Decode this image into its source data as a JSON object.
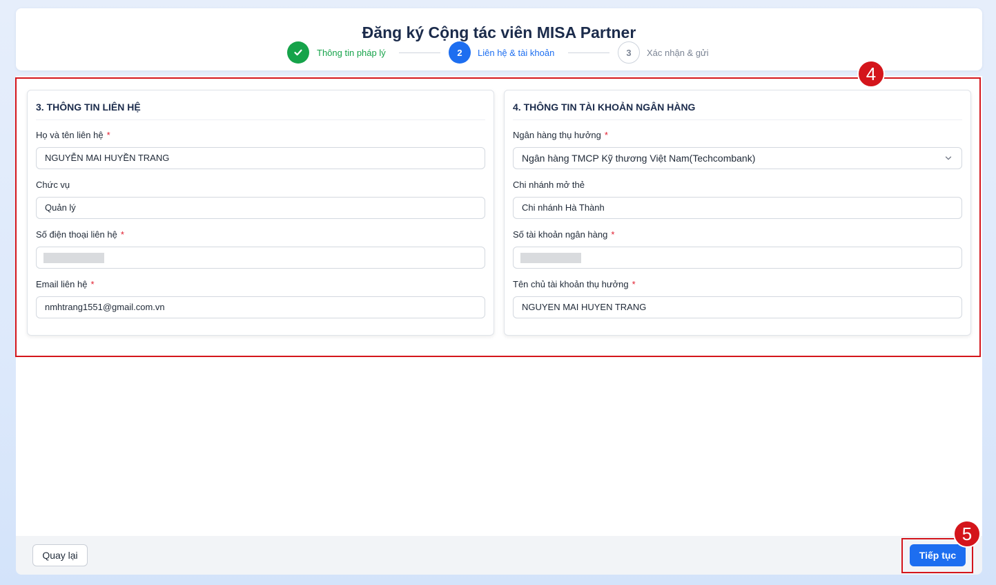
{
  "page": {
    "title": "Đăng ký Cộng tác viên MISA Partner"
  },
  "stepper": {
    "steps": [
      {
        "number": "",
        "label": "Thông tin pháp lý",
        "status": "done",
        "color": "#16a34a"
      },
      {
        "number": "2",
        "label": "Liên hệ & tài khoản",
        "status": "active",
        "color": "#1d6ef0"
      },
      {
        "number": "3",
        "label": "Xác nhận & gửi",
        "status": "pending",
        "color": "#7b8494"
      }
    ],
    "done_icon": "check-icon"
  },
  "contact_section": {
    "title": "3. THÔNG TIN LIÊN HỆ",
    "fields": [
      {
        "label": "Họ và tên liên hệ",
        "required": "*",
        "value": "NGUYỄN MAI HUYỀN TRANG"
      },
      {
        "label": "Chức vụ",
        "value": "Quản lý"
      },
      {
        "label": "Số điện thoại liên hệ",
        "required": "*",
        "value": "",
        "masked": true
      },
      {
        "label": "Email liên hệ",
        "required": "*",
        "value": "nmhtrang1551@gmail.com.vn"
      }
    ]
  },
  "bank_section": {
    "title": "4. THÔNG TIN TÀI KHOẢN NGÂN HÀNG",
    "fields": [
      {
        "label": "Ngân hàng thụ hưởng",
        "required": "*",
        "value": "Ngân hàng TMCP Kỹ thương Việt Nam(Techcombank)",
        "type": "select"
      },
      {
        "label": "Chi nhánh mở thẻ",
        "value": "Chi nhánh Hà Thành"
      },
      {
        "label": "Số tài khoản ngân hàng",
        "required": "*",
        "value": "",
        "masked": true
      },
      {
        "label": "Tên chủ tài khoản thụ hưởng",
        "required": "*",
        "value": "NGUYEN MAI HUYEN TRANG"
      }
    ]
  },
  "footer": {
    "back_label": "Quay lại",
    "next_label": "Tiếp tục"
  },
  "annotations": {
    "badge_4": "4",
    "badge_5": "5",
    "color": "#d4151b"
  }
}
